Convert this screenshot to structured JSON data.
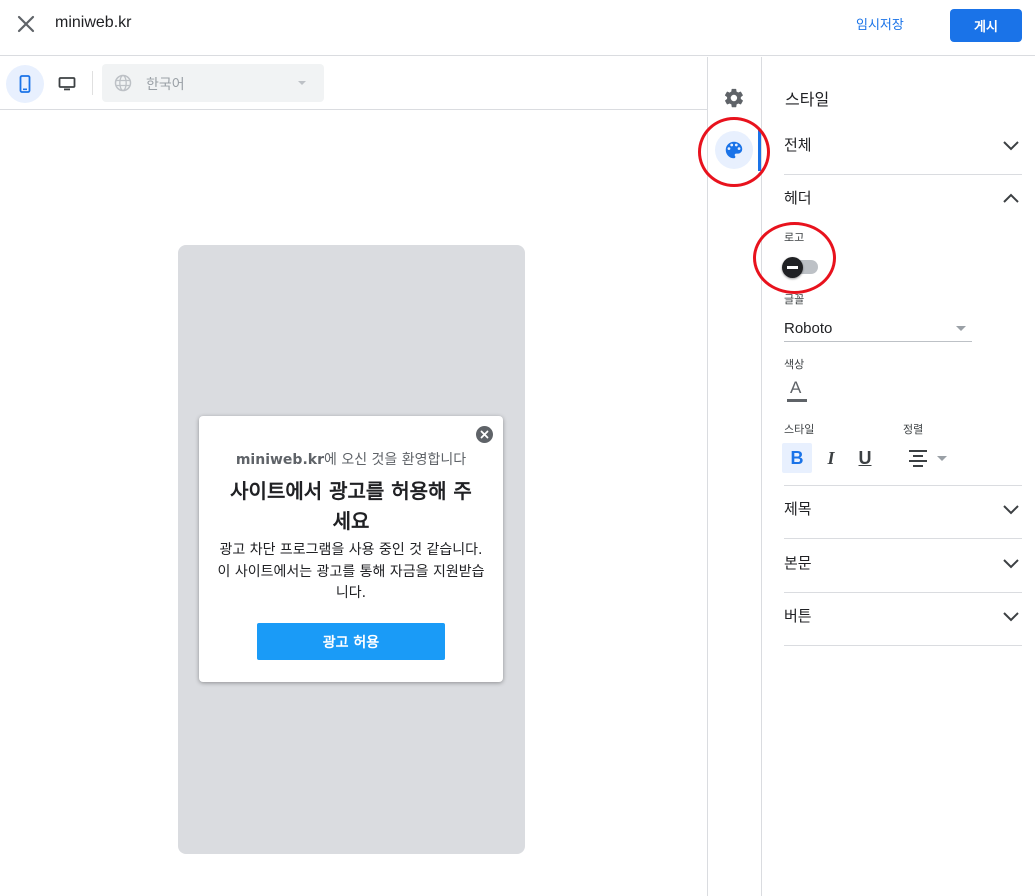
{
  "header": {
    "close_icon": "close-icon",
    "site_title": "miniweb.kr",
    "draft_label": "임시저장",
    "publish_label": "게시"
  },
  "preview_toolbar": {
    "mobile_icon": "smartphone-icon",
    "desktop_icon": "desktop-icon",
    "language_icon": "globe-icon",
    "language_value": "한국어"
  },
  "dialog": {
    "welcome_site": "miniweb.kr",
    "welcome_suffix": "에 오신 것을 환영합니다",
    "heading": "사이트에서 광고를 허용해 주세요",
    "body": "광고 차단 프로그램을 사용 중인 것 같습니다. 이 사이트에서는 광고를 통해 자금을 지원받습니다.",
    "button_label": "광고 허용"
  },
  "rail": {
    "settings_icon": "gear-icon",
    "style_icon": "palette-icon"
  },
  "panel": {
    "title": "스타일",
    "sections": {
      "overall": "전체",
      "header": "헤더",
      "title": "제목",
      "body": "본문",
      "button": "버튼"
    },
    "header_fields": {
      "logo_label": "로고",
      "logo_enabled": false,
      "font_label": "글꼴",
      "font_value": "Roboto",
      "color_label": "색상",
      "color_glyph": "A",
      "style_label": "스타일",
      "align_label": "정렬",
      "bold": "B",
      "italic": "I",
      "underline": "U",
      "bold_active": true
    }
  },
  "colors": {
    "accent": "#1a73e8",
    "annotation": "#e8121d",
    "ad_button": "#1a9bf7"
  }
}
